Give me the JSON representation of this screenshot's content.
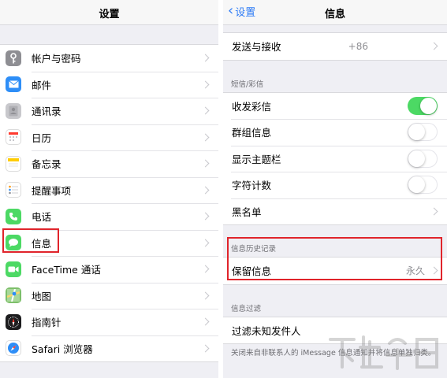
{
  "left": {
    "title": "设置",
    "items": [
      {
        "label": "帐户与密码",
        "icon": "key-icon",
        "color": "#8e8e93"
      },
      {
        "label": "邮件",
        "icon": "mail-icon",
        "color": "#2e8ef7"
      },
      {
        "label": "通讯录",
        "icon": "contacts-icon",
        "color": "#a8a8ae"
      },
      {
        "label": "日历",
        "icon": "calendar-icon",
        "color": "#ffffff"
      },
      {
        "label": "备忘录",
        "icon": "notes-icon",
        "color": "#f4f4f4"
      },
      {
        "label": "提醒事项",
        "icon": "reminders-icon",
        "color": "#ffffff"
      },
      {
        "label": "电话",
        "icon": "phone-icon",
        "color": "#4cd964"
      },
      {
        "label": "信息",
        "icon": "messages-icon",
        "color": "#4cd964"
      },
      {
        "label": "FaceTime 通话",
        "icon": "facetime-icon",
        "color": "#4cd964"
      },
      {
        "label": "地图",
        "icon": "maps-icon",
        "color": "#7dbf6a"
      },
      {
        "label": "指南针",
        "icon": "compass-icon",
        "color": "#1c1c1e"
      },
      {
        "label": "Safari 浏览器",
        "icon": "safari-icon",
        "color": "#2e8ef7"
      }
    ]
  },
  "right": {
    "back_label": "设置",
    "title": "信息",
    "send_receive": {
      "label": "发送与接收",
      "value": "+86"
    },
    "sms_header": "短信/彩信",
    "sms_rows": [
      {
        "label": "收发彩信",
        "toggle": true
      },
      {
        "label": "群组信息",
        "toggle": false
      },
      {
        "label": "显示主题栏",
        "toggle": false
      },
      {
        "label": "字符计数",
        "toggle": false
      }
    ],
    "blacklist_label": "黑名单",
    "history_header": "信息历史记录",
    "keep_messages": {
      "label": "保留信息",
      "value": "永久"
    },
    "filter_header": "信息过滤",
    "filter_label": "过滤未知发件人",
    "filter_footer": "关闭来自非联系人的 iMessage 信息通知并将信息单独归类。"
  },
  "accent_color": "#e0242b"
}
